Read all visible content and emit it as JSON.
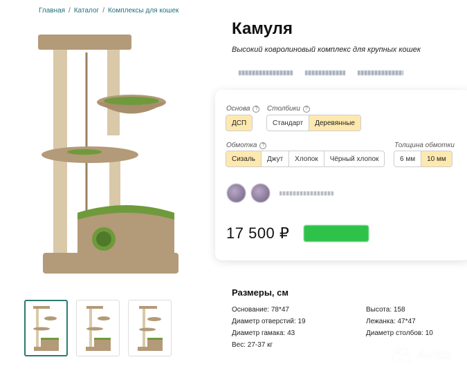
{
  "breadcrumb": [
    "Главная",
    "Каталог",
    "Комплексы для кошек"
  ],
  "product": {
    "title": "Камуля",
    "subtitle": "Высокий ковролиновый комплекс для крупных кошек"
  },
  "options": {
    "base": {
      "label": "Основа",
      "choices": [
        "ДСП"
      ],
      "selected": "ДСП"
    },
    "posts": {
      "label": "Столбики",
      "choices": [
        "Стандарт",
        "Деревянные"
      ],
      "selected": "Деревянные"
    },
    "wrap": {
      "label": "Обмотка",
      "choices": [
        "Сизаль",
        "Джут",
        "Хлопок",
        "Чёрный хлопок"
      ],
      "selected": "Сизаль"
    },
    "wrap_thickness": {
      "label": "Толщина обмотки",
      "choices": [
        "6 мм",
        "10 мм"
      ],
      "selected": "10 мм"
    }
  },
  "price": "17 500 ₽",
  "dimensions": {
    "title": "Размеры, см",
    "left": [
      "Основание: 78*47",
      "Диаметр отверстий: 19",
      "Диаметр гамака: 43",
      "Вес: 27-37 кг"
    ],
    "right": [
      "Высота: 158",
      "Лежанка: 47*47",
      "Диаметр столбов: 10"
    ]
  },
  "watermark": "Avito",
  "colors": {
    "accent": "#fde9b0",
    "link": "#1f6f7a",
    "buy": "#2ec24a",
    "carpet": "#b39a78",
    "green": "#6f9a3c",
    "sisal": "#d9c9a8"
  }
}
